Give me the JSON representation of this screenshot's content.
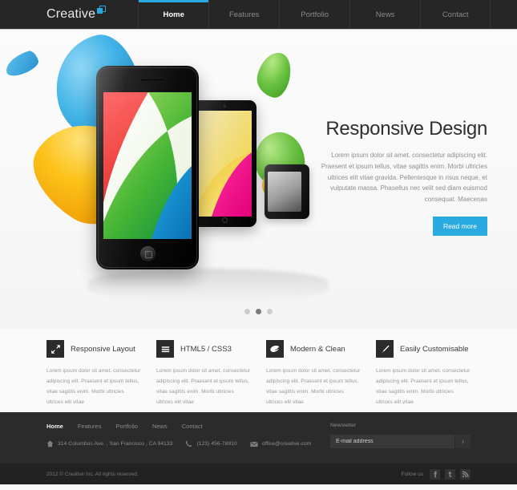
{
  "header": {
    "logo_text": "Creative",
    "logo_icon": "squares-logo-icon",
    "nav": [
      {
        "label": "Home",
        "active": true
      },
      {
        "label": "Features",
        "active": false
      },
      {
        "label": "Portfolio",
        "active": false
      },
      {
        "label": "News",
        "active": false
      },
      {
        "label": "Contact",
        "active": false
      }
    ]
  },
  "hero": {
    "title": "Responsive Design",
    "body": "Lorem ipsum dolor sit amet, consectetur adipiscing elit. Praesent et ipsum tellus, vitae sagittis enim. Morbi ultricies ultrices elit vitae gravida. Pellentesque in risus neque, et vulputate massa. Phasellus nec velit sed diam euismod consequat. Maecenas",
    "button_label": "Read more",
    "accent_color": "#29abe2",
    "slider_dots": 3,
    "slider_active_index": 1,
    "devices": [
      "smartphone",
      "tablet",
      "smartphone-small"
    ]
  },
  "features": [
    {
      "icon": "resize-arrows-icon",
      "title": "Responsive Layout",
      "text": "Lorem ipsum dolor sit amet, consectetur adipiscing elit. Praesent et ipsum tellus, vitae sagittis enim. Morbi ultricies ultrices elit vitae"
    },
    {
      "icon": "list-lines-icon",
      "title": "HTML5 / CSS3",
      "text": "Lorem ipsum dolor sit amet, consectetur adipiscing elit. Praesent et ipsum tellus, vitae sagittis enim. Morbi ultricies ultrices elit vitae"
    },
    {
      "icon": "leaf-icon",
      "title": "Modern & Clean",
      "text": "Lorem ipsum dolor sit amet, consectetur adipiscing elit. Praesent et ipsum tellus, vitae sagittis enim. Morbi ultricies ultrices elit vitae"
    },
    {
      "icon": "pencil-icon",
      "title": "Easily Customisable",
      "text": "Lorem ipsum dolor sit amet, consectetur adipiscing elit. Praesent et ipsum tellus, vitae sagittis enim. Morbi ultricies ultrices elit vitae"
    }
  ],
  "footer": {
    "nav": [
      {
        "label": "Home",
        "active": true
      },
      {
        "label": "Features",
        "active": false
      },
      {
        "label": "Portfolio",
        "active": false
      },
      {
        "label": "News",
        "active": false
      },
      {
        "label": "Contact",
        "active": false
      }
    ],
    "contacts": [
      {
        "icon": "home-icon",
        "text": "314 Columbus Ave. , San Francisco , CA 94133"
      },
      {
        "icon": "phone-icon",
        "text": "(123) 456-78910"
      },
      {
        "icon": "envelope-icon",
        "text": "office@creative.com"
      }
    ],
    "newsletter": {
      "label": "Newsletter",
      "placeholder": "E-mail address",
      "value": "",
      "submit_label": "›"
    }
  },
  "bottombar": {
    "copyright": "2012 © Creative Inc. All rights reserved.",
    "follow_label": "Follow us",
    "socials": [
      {
        "icon": "facebook-icon",
        "name": "Facebook"
      },
      {
        "icon": "twitter-icon",
        "name": "Twitter"
      },
      {
        "icon": "rss-icon",
        "name": "RSS"
      }
    ]
  }
}
